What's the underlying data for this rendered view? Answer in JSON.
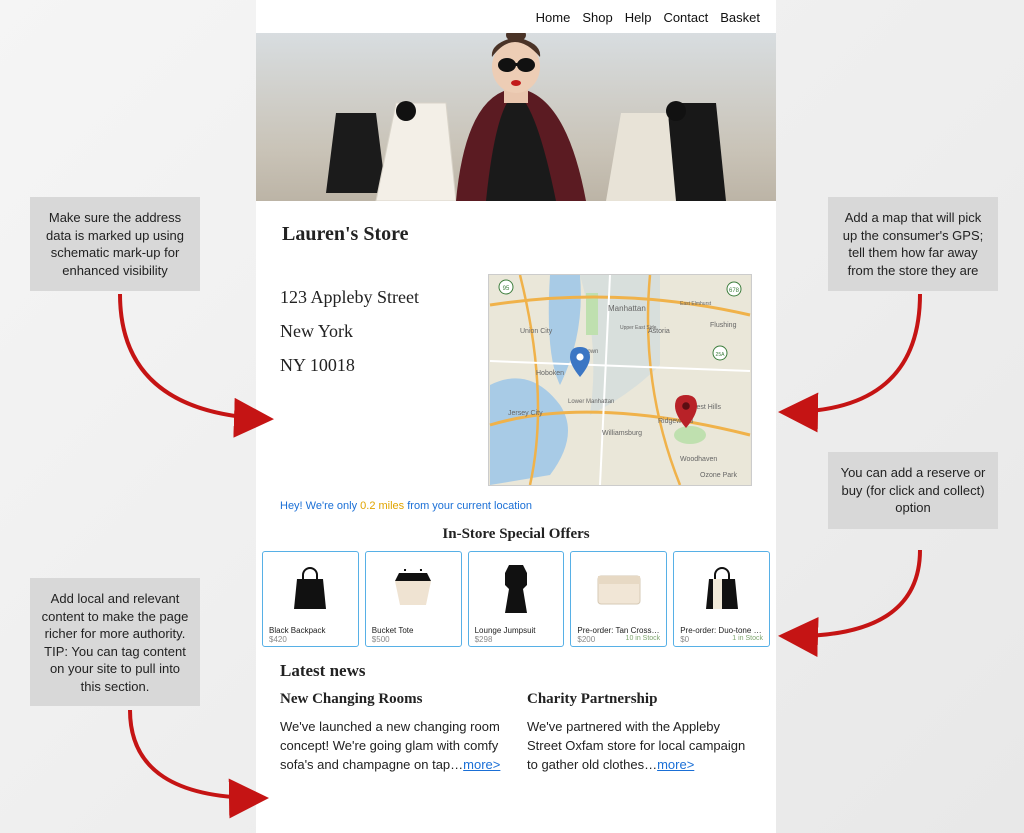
{
  "nav": {
    "items": [
      "Home",
      "Shop",
      "Help",
      "Contact",
      "Basket"
    ]
  },
  "store": {
    "name": "Lauren's Store",
    "address_line1": "123 Appleby Street",
    "address_city": "New York",
    "address_zip": "NY 10018"
  },
  "distance": {
    "prefix": "Hey! We're only ",
    "value": "0.2 miles",
    "suffix": " from your current location"
  },
  "offers_heading": "In-Store Special Offers",
  "products": [
    {
      "name": "Black Backpack",
      "price": "$420",
      "stock": ""
    },
    {
      "name": "Bucket Tote",
      "price": "$500",
      "stock": ""
    },
    {
      "name": "Lounge Jumpsuit",
      "price": "$298",
      "stock": ""
    },
    {
      "name": "Pre-order: Tan Crossbody",
      "price": "$200",
      "stock": "10 in Stock"
    },
    {
      "name": "Pre-order: Duo-tone Bac…",
      "price": "$0",
      "stock": "1 in Stock"
    }
  ],
  "news_heading": "Latest news",
  "news": [
    {
      "title": "New Changing Rooms",
      "body": "We've launched a new changing room concept! We're going glam with comfy sofa's and champagne on tap…",
      "more": "more>"
    },
    {
      "title": "Charity Partnership",
      "body": "We've partnered with the Appleby Street Oxfam store for local campaign to gather old clothes…",
      "more": "more>"
    }
  ],
  "map_labels": [
    "Manhattan",
    "Union City",
    "Hoboken",
    "Jersey City",
    "Astoria",
    "Flushing",
    "Williamsburg",
    "Ridgewood",
    "Forest Hills",
    "Woodhaven",
    "Ozone Park",
    "Lower Manhattan",
    "Midtown",
    "Upper East Side",
    "East Elmhurst"
  ],
  "annotations": {
    "a1": "Make sure the address data is marked up using schematic mark-up for enhanced visibility",
    "a2": "Add a map that will pick up the consumer's GPS; tell them how far away from the store they are",
    "a3": "You can add a reserve or buy (for click and collect) option",
    "a4": "Add local and relevant content to make the page richer for more authority. TIP: You can tag content on your site to pull into this section."
  }
}
